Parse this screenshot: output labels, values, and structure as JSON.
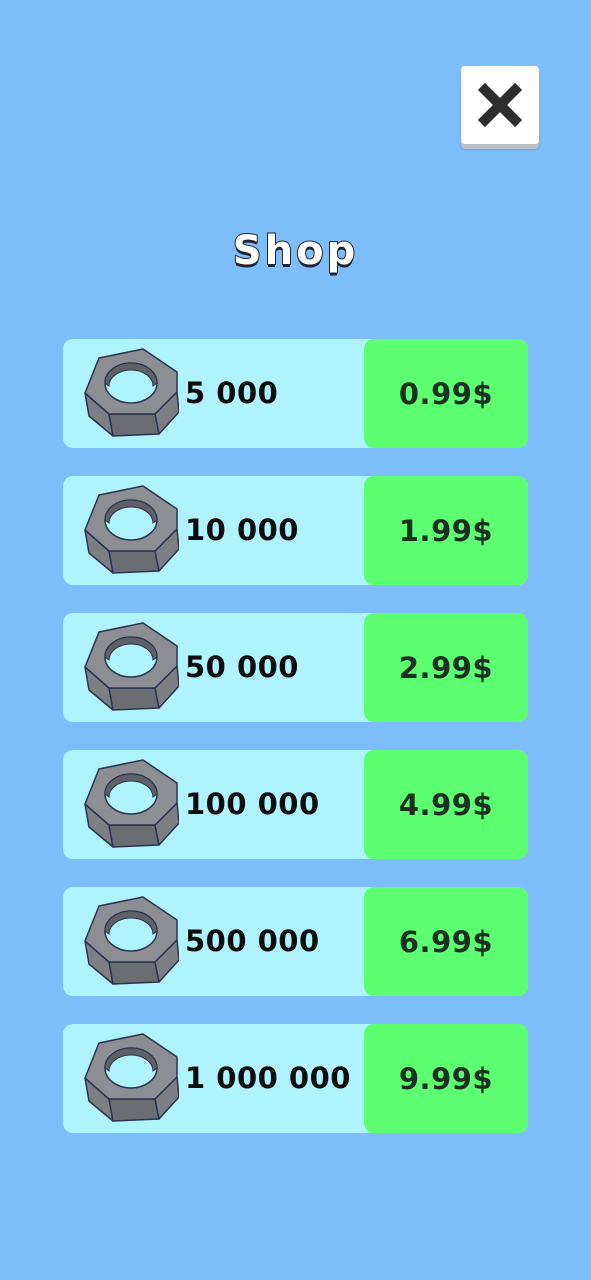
{
  "shop": {
    "title": "Shop",
    "close_icon": "close-x-icon",
    "item_icon": "hex-nut-icon",
    "colors": {
      "background": "#7dbdfb",
      "row": "#aef3fe",
      "price_button": "#5cff6f"
    },
    "items": [
      {
        "amount": "5 000",
        "price": "0.99$"
      },
      {
        "amount": "10 000",
        "price": "1.99$"
      },
      {
        "amount": "50 000",
        "price": "2.99$"
      },
      {
        "amount": "100 000",
        "price": "4.99$"
      },
      {
        "amount": "500 000",
        "price": "6.99$"
      },
      {
        "amount": "1 000 000",
        "price": "9.99$"
      }
    ]
  }
}
